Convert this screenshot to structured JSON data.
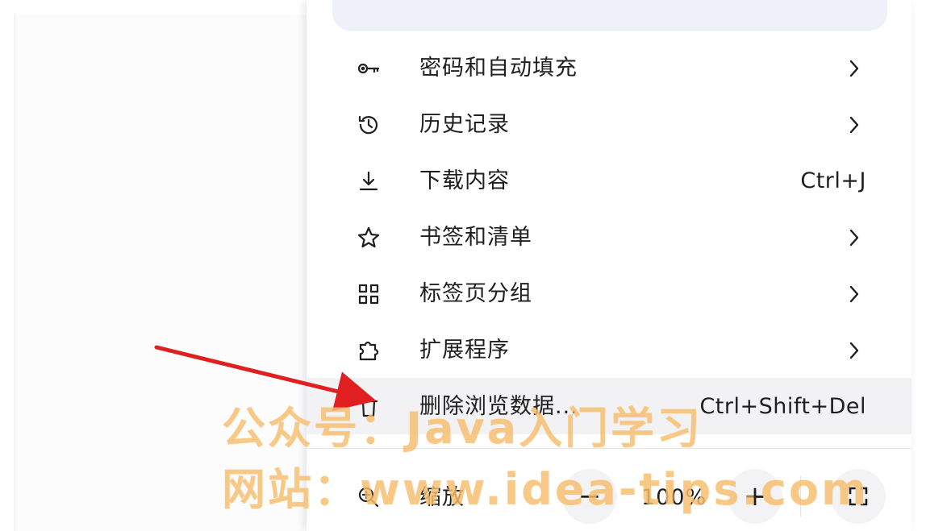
{
  "menu": {
    "items": [
      {
        "label": "密码和自动填充",
        "icon": "key-icon",
        "trailing": "chevron"
      },
      {
        "label": "历史记录",
        "icon": "history-icon",
        "trailing": "chevron"
      },
      {
        "label": "下载内容",
        "icon": "download-icon",
        "shortcut": "Ctrl+J"
      },
      {
        "label": "书签和清单",
        "icon": "star-icon",
        "trailing": "chevron"
      },
      {
        "label": "标签页分组",
        "icon": "grid-icon",
        "trailing": "chevron"
      },
      {
        "label": "扩展程序",
        "icon": "puzzle-icon",
        "trailing": "chevron"
      },
      {
        "label": "删除浏览数据...",
        "icon": "trash-icon",
        "shortcut": "Ctrl+Shift+Del",
        "highlighted": true
      }
    ],
    "zoom": {
      "label": "缩放",
      "minus": "−",
      "value": "100%",
      "plus": "+",
      "fullscreen_icon": "fullscreen-icon"
    }
  },
  "watermark": {
    "line1": "公众号：Java入门学习",
    "line2": "网站：www.idea-tips.com"
  },
  "annotation": {
    "arrow_color": "#e02020"
  }
}
